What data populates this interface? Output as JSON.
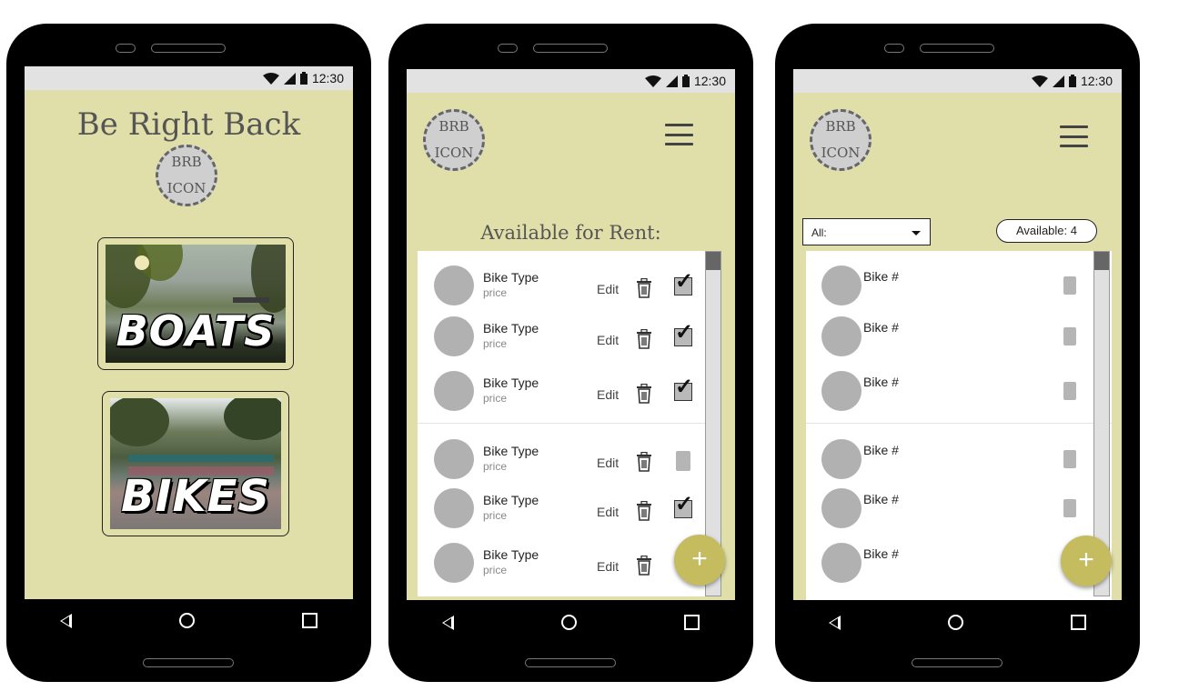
{
  "status_bar": {
    "time": "12:30"
  },
  "screen1": {
    "title": "Be Right Back",
    "logo": {
      "line1": "BRB",
      "line2": "ICON"
    },
    "tiles": [
      {
        "label": "BOATS"
      },
      {
        "label": "BIKES"
      }
    ]
  },
  "screen2": {
    "logo": {
      "line1": "BRB",
      "line2": "ICON"
    },
    "heading": "Available for Rent:",
    "rows": [
      {
        "title": "Bike Type",
        "sub": "price",
        "edit": "Edit",
        "checked": true
      },
      {
        "title": "Bike Type",
        "sub": "price",
        "edit": "Edit",
        "checked": true
      },
      {
        "title": "Bike Type",
        "sub": "price",
        "edit": "Edit",
        "checked": true
      },
      {
        "title": "Bike Type",
        "sub": "price",
        "edit": "Edit",
        "checked": false
      },
      {
        "title": "Bike Type",
        "sub": "price",
        "edit": "Edit",
        "checked": true
      },
      {
        "title": "Bike Type",
        "sub": "price",
        "edit": "Edit",
        "checked": null
      }
    ],
    "fab": "+"
  },
  "screen3": {
    "logo": {
      "line1": "BRB",
      "line2": "ICON"
    },
    "filter": {
      "selected": "All:"
    },
    "available": "Available: 4",
    "rows": [
      {
        "title": "Bike #"
      },
      {
        "title": "Bike #"
      },
      {
        "title": "Bike #"
      },
      {
        "title": "Bike #"
      },
      {
        "title": "Bike #"
      },
      {
        "title": "Bike #"
      }
    ],
    "fab": "+"
  },
  "colors": {
    "screen_bg": "#e1dfa9",
    "fab": "#c5bc5f",
    "avatar": "#b1b1b1"
  },
  "icons": [
    "wifi-icon",
    "signal-icon",
    "battery-icon",
    "hamburger-menu-icon",
    "trash-icon",
    "checkbox-icon",
    "back-icon",
    "home-icon",
    "recents-icon",
    "chevron-down-icon"
  ]
}
